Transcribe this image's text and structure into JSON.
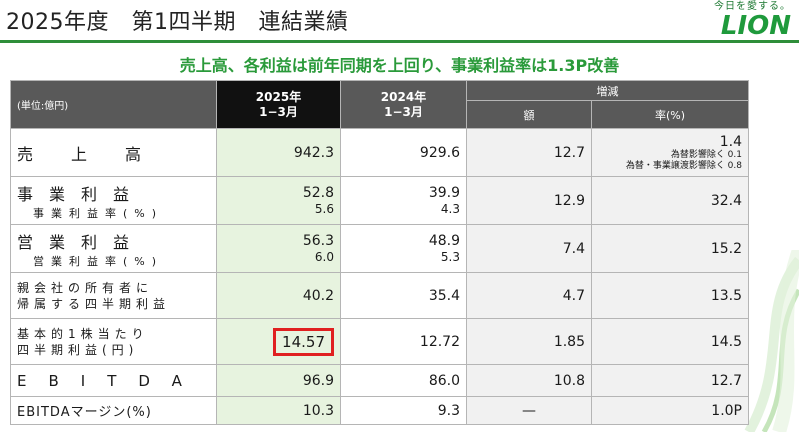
{
  "slide": {
    "title": "2025年度　第1四半期　連結業績",
    "headline": "売上高、各利益は前年同期を上回り、事業利益率は1.3P改善"
  },
  "logo": {
    "tagline": "今日を愛する。",
    "word": "LION"
  },
  "table": {
    "unit_label": "(単位:億円)",
    "current_header": [
      "2025年",
      "1−3月"
    ],
    "previous_header": [
      "2024年",
      "1−3月"
    ],
    "change_header": "増減",
    "change_amount_header": "額",
    "change_rate_header": "率(%)",
    "rows": [
      {
        "label": "売上高",
        "current": "942.3",
        "previous": "929.6",
        "change_amount": "12.7",
        "change_rate": "1.4",
        "notes": [
          "為替影響除く 0.1",
          "為替・事業譲渡影響除く 0.8"
        ]
      },
      {
        "label": "事業利益",
        "sublabel": "事業利益率(%)",
        "current": "52.8",
        "current_sub": "5.6",
        "previous": "39.9",
        "previous_sub": "4.3",
        "change_amount": "12.9",
        "change_rate": "32.4"
      },
      {
        "label": "営業利益",
        "sublabel": "営業利益率(%)",
        "current": "56.3",
        "current_sub": "6.0",
        "previous": "48.9",
        "previous_sub": "5.3",
        "change_amount": "7.4",
        "change_rate": "15.2"
      },
      {
        "label_lines": [
          "親会社の所有者に",
          "帰属する四半期利益"
        ],
        "current": "40.2",
        "previous": "35.4",
        "change_amount": "4.7",
        "change_rate": "13.5"
      },
      {
        "label_lines": [
          "基本的1株当たり",
          "四半期利益(円)"
        ],
        "current": "14.57",
        "previous": "12.72",
        "change_amount": "1.85",
        "change_rate": "14.5"
      },
      {
        "label": "EBITDA",
        "current": "96.9",
        "previous": "86.0",
        "change_amount": "10.8",
        "change_rate": "12.7"
      },
      {
        "label": "EBITDAマージン(%)",
        "current": "10.3",
        "previous": "9.3",
        "change_amount": "—",
        "change_rate": "1.0P"
      }
    ]
  }
}
